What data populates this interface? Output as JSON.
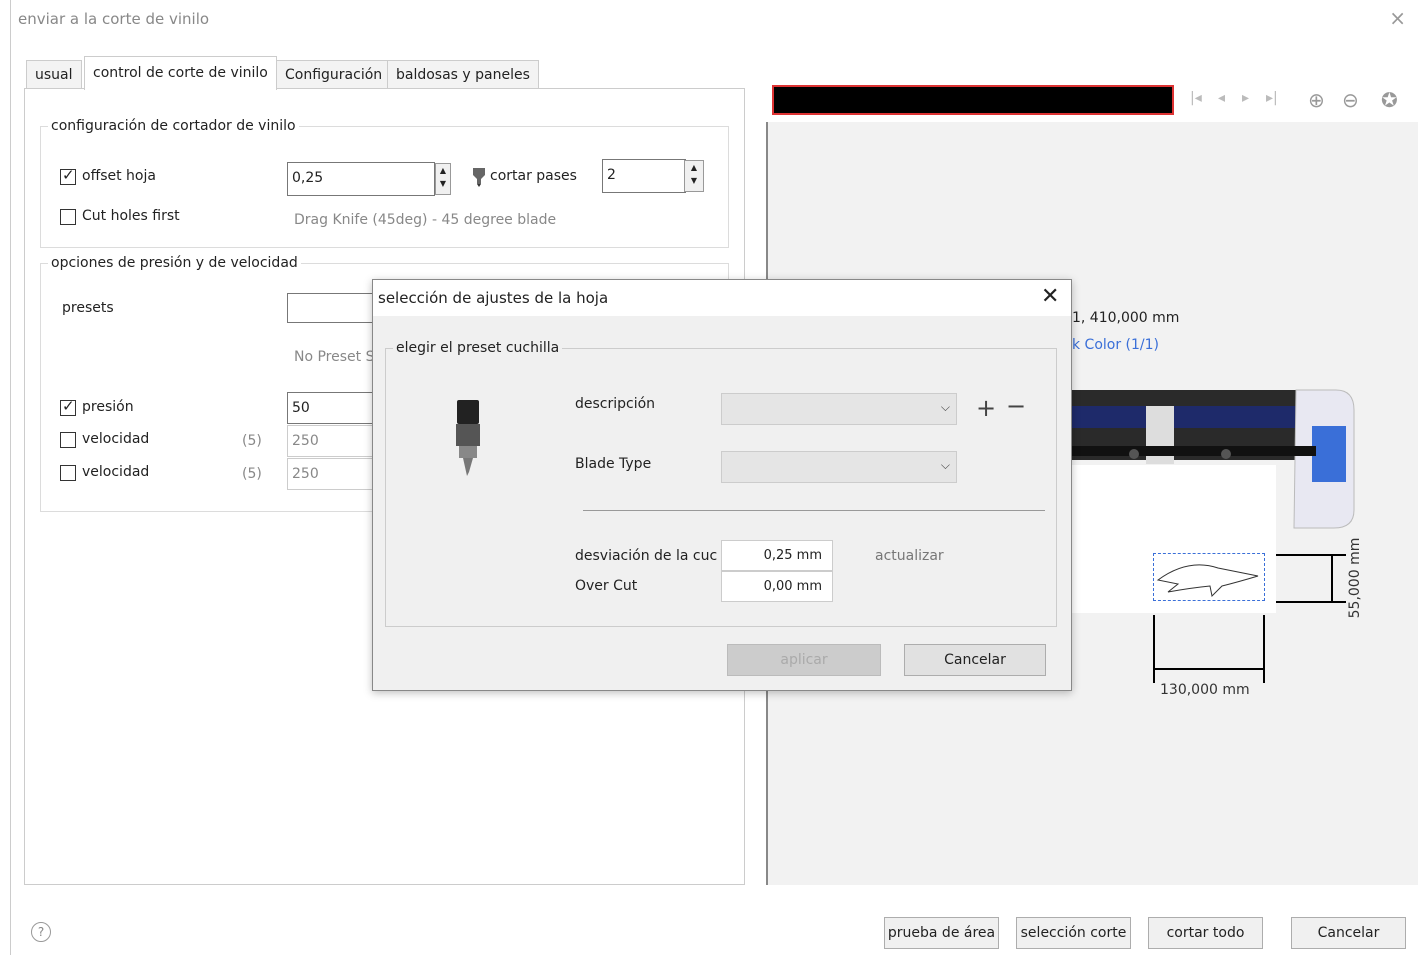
{
  "window": {
    "title": "enviar a la corte de vinilo",
    "close": "×"
  },
  "tabs": [
    "usual",
    "control de corte de vinilo",
    "Configuración",
    "baldosas y paneles"
  ],
  "cutter": {
    "legend": "configuración de cortador de vinilo",
    "offset_label": "offset hoja",
    "offset_value": "0,25",
    "passes_label": "cortar pases",
    "passes_value": "2",
    "cut_holes_label": "Cut holes first",
    "blade_desc": "Drag Knife (45deg) - 45 degree blade"
  },
  "pressure": {
    "legend": "opciones de presión y de velocidad",
    "presets_label": "presets",
    "no_preset": "No Preset S",
    "presion_label": "presión",
    "presion_value": "50",
    "velocidad1_label": "velocidad",
    "velocidad1_count": "(5)",
    "velocidad1_value": "250",
    "velocidad2_label": "velocidad",
    "velocidad2_count": "(5)",
    "velocidad2_value": "250"
  },
  "preview": {
    "coords": "1,  410,000 mm",
    "color_link": "k Color (1/1)",
    "width_dim": "130,000 mm",
    "height_dim": "55,000 mm"
  },
  "dialog": {
    "title": "selección de ajustes de la hoja",
    "legend": "elegir el preset cuchilla",
    "descripcion_label": "descripción",
    "blade_type_label": "Blade Type",
    "plus": "+",
    "minus": "−",
    "desviacion_label": "desviación de la cuc",
    "desviacion_value": "0,25 mm",
    "overcut_label": "Over Cut",
    "overcut_value": "0,00 mm",
    "actualizar": "actualizar",
    "aplicar": "aplicar",
    "cancelar": "Cancelar"
  },
  "footer": {
    "help": "?",
    "prueba": "prueba de área",
    "seleccion": "selección corte",
    "cortar_todo": "cortar todo",
    "cancelar": "Cancelar"
  },
  "colors": {
    "accent_blue": "#3a6fd8",
    "black_bar_border": "#dd3333"
  }
}
